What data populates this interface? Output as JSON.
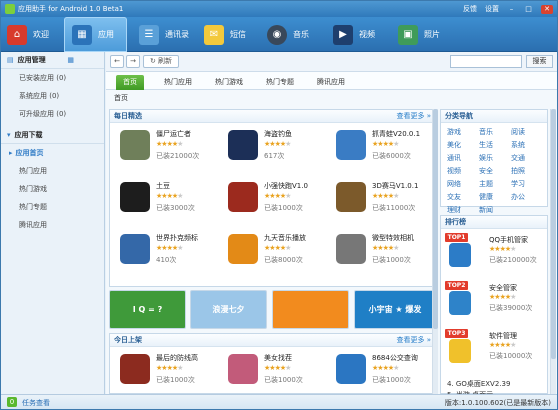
{
  "window": {
    "title": "应用助手 for Android 1.0 Beta1",
    "feedback": "反馈",
    "settings": "设置"
  },
  "nav": [
    {
      "label": "欢迎"
    },
    {
      "label": "应用"
    },
    {
      "label": "通讯录"
    },
    {
      "label": "短信"
    },
    {
      "label": "音乐"
    },
    {
      "label": "视频"
    },
    {
      "label": "照片"
    }
  ],
  "sidebar": {
    "apps_header": "应用管理",
    "apps_items": [
      "已安装应用 (0)",
      "系统应用 (0)",
      "可升级应用 (0)"
    ],
    "download_header": "应用下载",
    "download_items": [
      "应用首页",
      "热门应用",
      "热门游戏",
      "热门专题",
      "腾讯应用"
    ]
  },
  "toolbar": {
    "back": "←",
    "forward": "→",
    "refresh": "刷新",
    "search_placeholder": "",
    "search_button": "搜索"
  },
  "tabs": [
    "首页",
    "热门应用",
    "热门游戏",
    "热门专题",
    "腾讯应用"
  ],
  "breadcrumb": "首页",
  "featured": {
    "title": "每日精选",
    "more": "查看更多 »",
    "apps": [
      {
        "name": "僵尸运亡者",
        "stars": 4,
        "downloads": "已装21000次",
        "color": "#6f7f5a"
      },
      {
        "name": "海盗钓鱼",
        "stars": 4,
        "downloads": "617次",
        "color": "#1c2f57"
      },
      {
        "name": "抓青蛙V20.0.1",
        "stars": 4,
        "downloads": "已装6000次",
        "color": "#3a7cc4"
      },
      {
        "name": "土豆",
        "stars": 4,
        "downloads": "已装3000次",
        "color": "#1d1d1d"
      },
      {
        "name": "小强快跑V1.0",
        "stars": 4,
        "downloads": "已装1000次",
        "color": "#9c2a1e"
      },
      {
        "name": "3D赛马V1.0.1",
        "stars": 4,
        "downloads": "已装11000次",
        "color": "#7c5a2b"
      },
      {
        "name": "世界扑克频标",
        "stars": 4,
        "downloads": "410次",
        "color": "#3468a8"
      },
      {
        "name": "九天音乐播放",
        "stars": 4,
        "downloads": "已装8000次",
        "color": "#e38a17"
      },
      {
        "name": "微型特效相机",
        "stars": 4,
        "downloads": "已装1000次",
        "color": "#777777"
      }
    ]
  },
  "banners": [
    {
      "text": "I Q = ?",
      "color": "#3f9a3a"
    },
    {
      "text": "浪漫七夕",
      "color": "#9bc6e8"
    },
    {
      "text": "",
      "color": "#f28b1e"
    },
    {
      "text": "小宇宙 ★ 爆发",
      "color": "#1f7fc6"
    }
  ],
  "today": {
    "title": "今日上架",
    "more": "查看更多 »",
    "apps": [
      {
        "name": "最后的防线高",
        "stars": 4,
        "downloads": "已装1000次",
        "color": "#8c2b1f"
      },
      {
        "name": "美女找茬",
        "stars": 4,
        "downloads": "已装1000次",
        "color": "#c25b7a"
      },
      {
        "name": "8684公交查询",
        "stars": 4,
        "downloads": "已装1000次",
        "color": "#2b76c2"
      }
    ]
  },
  "categories": {
    "title": "分类导航",
    "items": [
      "游戏",
      "音乐",
      "阅读",
      "美化",
      "生活",
      "系统",
      "通讯",
      "娱乐",
      "交通",
      "视频",
      "安全",
      "拍照",
      "网络",
      "主题",
      "学习",
      "交友",
      "健康",
      "办公",
      "理财",
      "新闻"
    ]
  },
  "ranking": {
    "title": "排行榜",
    "items": [
      {
        "badge": "TOP1",
        "name": "QQ手机管家",
        "stars": 4,
        "downloads": "已装210000次",
        "color": "#2c7cc7"
      },
      {
        "badge": "TOP2",
        "name": "安全管家",
        "stars": 4,
        "downloads": "已装39000次",
        "color": "#2e83c9"
      },
      {
        "badge": "TOP3",
        "name": "软件管理",
        "stars": 4,
        "downloads": "已装10000次",
        "color": "#f0c12b"
      }
    ],
    "more": [
      "4. GO桌面EXV2.39",
      "5. 当游·桌面示"
    ]
  },
  "status": {
    "count": "0",
    "task": "任务查看",
    "version": "版本:1.0.100.602(已是最新版本)"
  }
}
